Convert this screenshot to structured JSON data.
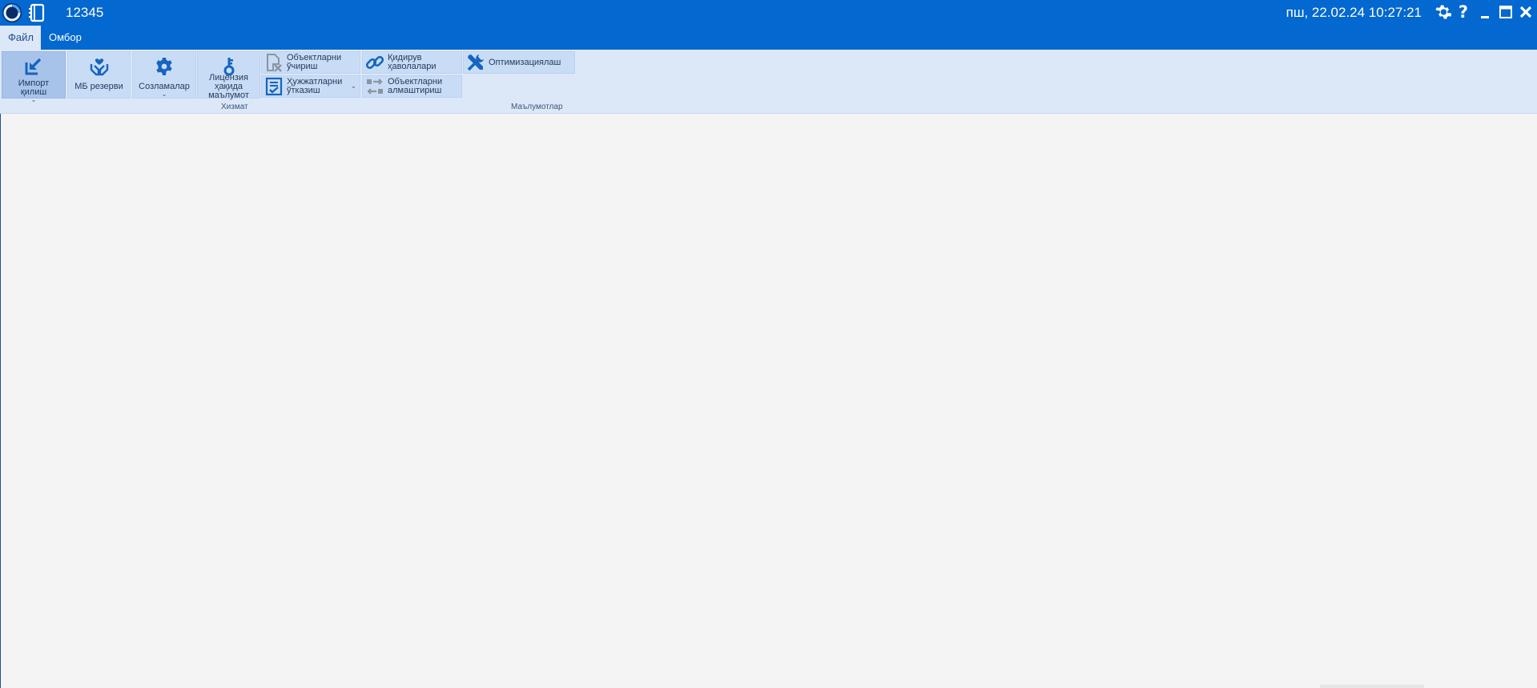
{
  "titlebar": {
    "title": "12345",
    "datetime": "пш, 22.02.24 10:27:21",
    "icons": [
      "app-logo-icon",
      "notebook-icon",
      "gear-icon",
      "help-icon",
      "minimize-icon",
      "maximize-icon",
      "close-icon"
    ]
  },
  "menu": {
    "tabs": [
      {
        "label": "Файл",
        "active": true
      },
      {
        "label": "Омбор",
        "active": false
      }
    ]
  },
  "ribbon": {
    "groups": [
      {
        "label": "Хизмат"
      },
      {
        "label": "Маълумотлар"
      }
    ],
    "buttons": {
      "import": {
        "label": "Импорт қилиш",
        "icon": "import-icon"
      },
      "backup": {
        "label": "МБ резерви",
        "icon": "hands-heart-icon"
      },
      "settings": {
        "label": "Созламалар",
        "icon": "gear-icon"
      },
      "license": {
        "label": "Лицензия ҳақида маълумот",
        "icon": "key-icon"
      },
      "delete_objects": {
        "label": "Объектларни ўчириш",
        "icon": "delete-document-icon"
      },
      "post_documents": {
        "label": "Ҳужжатларни ўтказиш",
        "icon": "checked-document-icon"
      },
      "search_links": {
        "label": "Қидирув ҳаволалари",
        "icon": "link-icon"
      },
      "swap_objects": {
        "label": "Объектларни алмаштириш",
        "icon": "swap-icon"
      },
      "optimization": {
        "label": "Оптимизациялаш",
        "icon": "tools-icon"
      }
    }
  },
  "colors": {
    "titlebar_bg": "#0368cf",
    "ribbon_bg": "#dce8f8",
    "button_bg": "#c9dcf6",
    "workspace_bg": "#f4f4f4",
    "icon_blue": "#1565c0",
    "icon_gray": "#8a95a3"
  }
}
